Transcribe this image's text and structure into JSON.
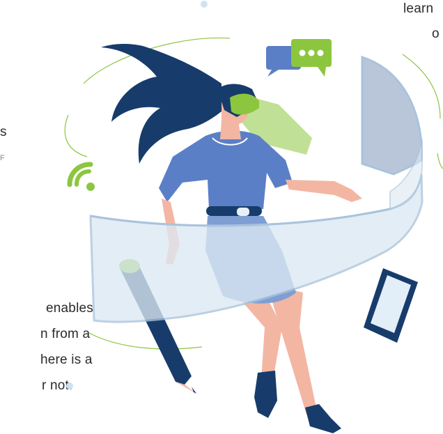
{
  "text_fragments": {
    "top_right_line1": "learn",
    "top_right_line2": "o",
    "left_s": "s",
    "left_tick": "F",
    "bottom_left_line1": "enables",
    "bottom_left_line2": "n from a",
    "bottom_left_line3": "here is a",
    "bottom_left_line4": "r not."
  },
  "colors": {
    "navy": "#173c6b",
    "green": "#8cc63f",
    "blue_shirt": "#5b7fc6",
    "skirt": "#7f9ed4",
    "skin": "#f3b6a3",
    "glass": "#dce9f3",
    "glass_edge": "#a9c3dc",
    "accent_dot": "#cfe2ef"
  },
  "icons": [
    "vr-headset-icon",
    "chat-bubbles-icon",
    "wifi-icon",
    "pencil-icon",
    "tablet-icon",
    "hologram-screen-icon"
  ]
}
